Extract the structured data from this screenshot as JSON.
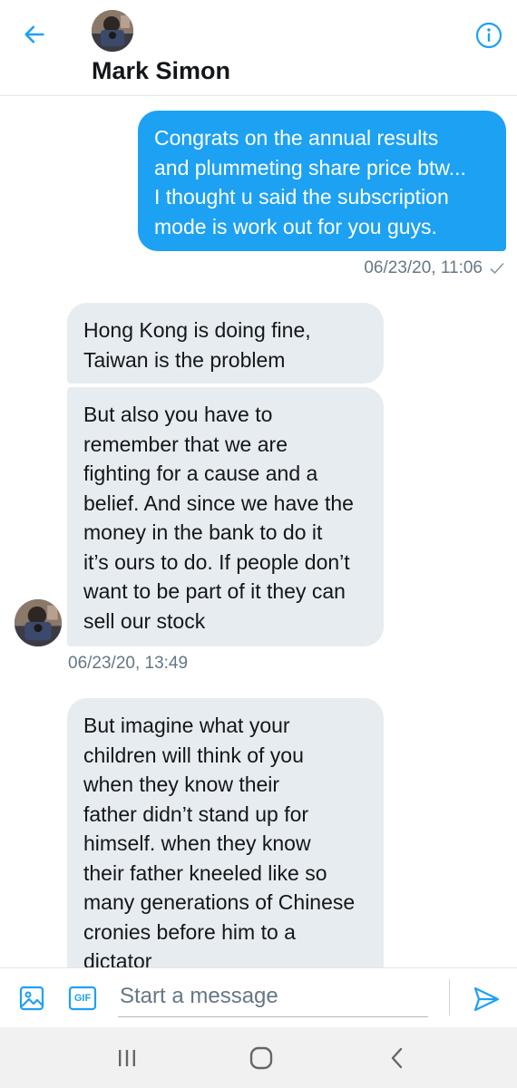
{
  "header": {
    "contact_name": "Mark Simon",
    "back_icon": "arrow-left-icon",
    "info_icon": "info-icon",
    "accent_color": "#1da1f2"
  },
  "messages": [
    {
      "direction": "outgoing",
      "text": "Congrats on the annual results\nand plummeting share price btw...\nI thought u said the subscription\nmode is work out for you guys.",
      "timestamp": "06/23/20, 11:06",
      "status_icon": "checkmark-icon"
    },
    {
      "direction": "incoming",
      "text": "Hong Kong is doing fine,\nTaiwan is the problem"
    },
    {
      "direction": "incoming",
      "text": "But also you have to\nremember that we are\nfighting for a cause and a\nbelief. And since we have the\nmoney in the bank to do it\nit’s ours to do. If people don’t\nwant to be part of it they can\nsell our stock",
      "timestamp": "06/23/20, 13:49"
    },
    {
      "direction": "incoming",
      "text": "But imagine what your\nchildren will think of you\nwhen they know their\nfather didn’t stand up for\nhimself.  when they know\ntheir father kneeled like so\nmany generations of Chinese\ncronies before him to a\ndictator"
    }
  ],
  "composer": {
    "placeholder": "Start a message",
    "media_icon": "image-icon",
    "gif_label": "GIF",
    "send_icon": "send-icon"
  },
  "navbar": {
    "recents_icon": "recents-icon",
    "home_icon": "home-icon",
    "back_icon": "nav-back-icon"
  }
}
